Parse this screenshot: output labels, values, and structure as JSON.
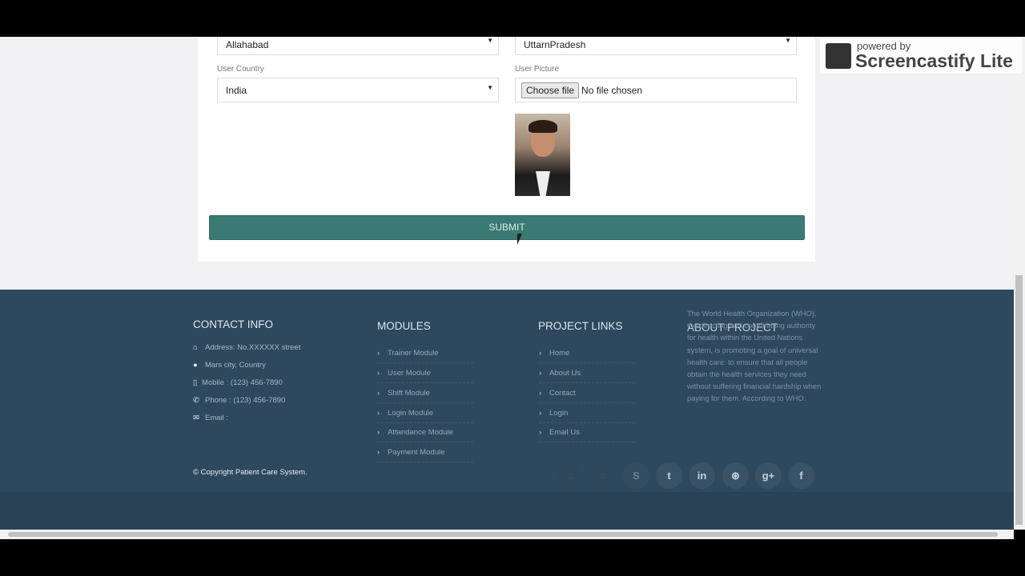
{
  "form": {
    "city": "Allahabad",
    "state": "UttarnPradesh",
    "country_label": "User Country",
    "country": "India",
    "picture_label": "User Picture",
    "choose_file": "Choose file",
    "no_file": "No file chosen",
    "submit": "SUBMIT"
  },
  "footer": {
    "contact": {
      "title": "CONTACT INFO",
      "items": [
        {
          "icon": "home-icon",
          "text": "Address: No.XXXXXX street"
        },
        {
          "icon": "globe-icon",
          "text": "Mars city, Country"
        },
        {
          "icon": "mobile-icon",
          "text": "Mobile : (123) 456-7890"
        },
        {
          "icon": "phone-icon",
          "text": "Phone : (123) 456-7890"
        },
        {
          "icon": "envelope-icon",
          "text": "Email :"
        }
      ]
    },
    "modules": {
      "title": "MODULES",
      "items": [
        "Trainer Module",
        "User Module",
        "Shift Module",
        "Login Module",
        "Attandance Module",
        "Payment Module"
      ]
    },
    "links": {
      "title": "PROJECT LINKS",
      "items": [
        "Home",
        "About Us",
        "Contact",
        "Login",
        "Email Us"
      ]
    },
    "about": {
      "title": "ABOUT PROJECT",
      "text": "The World Health Organization (WHO), the directing and coordinating authority for health within the United Nations system, is promoting a goal of universal health care: to ensure that all people obtain the health services they need without suffering financial hardship when paying for them. According to WHO."
    },
    "copyright": "© Copyright Patient Care System.",
    "social": [
      "home-icon",
      "github-icon",
      "skype-icon",
      "twitter-icon",
      "linkedin-icon",
      "dribbble-icon",
      "google-plus-icon",
      "facebook-icon"
    ]
  },
  "watermark": {
    "line1": "powered by",
    "line2": "Screencastify Lite"
  }
}
